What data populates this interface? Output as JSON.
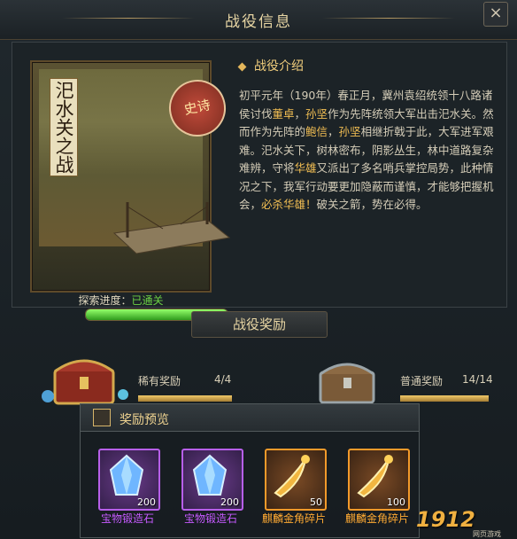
{
  "window": {
    "title": "战役信息",
    "close_label": "×"
  },
  "battle_card": {
    "name": "汜水关之战",
    "seal": "史诗",
    "progress_label": "探索进度：",
    "progress_status": "已通关",
    "progress": 1.0
  },
  "intro": {
    "heading": "战役介绍",
    "text_segments": [
      {
        "t": "初平元年（190年）春正月，冀州袁绍统领十八路诸侯讨伐",
        "style": "normal"
      },
      {
        "t": "董卓",
        "style": "gold"
      },
      {
        "t": "，",
        "style": "normal"
      },
      {
        "t": "孙坚",
        "style": "gold"
      },
      {
        "t": "作为先阵统领大军出击汜水关。然而作为先阵的",
        "style": "normal"
      },
      {
        "t": "鲍信",
        "style": "gold"
      },
      {
        "t": "，",
        "style": "normal"
      },
      {
        "t": "孙坚",
        "style": "gold"
      },
      {
        "t": "相继折戟于此，大军进军艰难。汜水关下，树林密布，阴影丛生，林中道路复杂难辨，守将",
        "style": "normal"
      },
      {
        "t": "华雄",
        "style": "gold"
      },
      {
        "t": "又派出了多名哨兵掌控局势，此种情况之下，我军行动要更加隐蔽而谨慎，才能够把握机会，",
        "style": "normal"
      },
      {
        "t": "必杀华雄！",
        "style": "gold"
      },
      {
        "t": "破关之箭，势在必得。",
        "style": "normal"
      }
    ]
  },
  "rewards": {
    "title": "战役奖励",
    "rare": {
      "label": "稀有奖励",
      "count": "4/4",
      "progress": 1.0
    },
    "normal": {
      "label": "普通奖励",
      "count": "14/14",
      "progress": 1.0
    }
  },
  "preview": {
    "title": "奖励预览",
    "items": [
      {
        "name": "宝物锻造石",
        "qty": "200",
        "rarity": "purple",
        "icon": "crystal-icon"
      },
      {
        "name": "宝物锻造石",
        "qty": "200",
        "rarity": "purple",
        "icon": "crystal-icon"
      },
      {
        "name": "麒麟金角碎片",
        "qty": "50",
        "rarity": "orange",
        "icon": "horn-icon"
      },
      {
        "name": "麒麟金角碎片",
        "qty": "100",
        "rarity": "orange",
        "icon": "horn-icon"
      }
    ]
  },
  "watermark": {
    "brand": "1912",
    "sub": "网页游戏"
  },
  "colors": {
    "gold": "#f3bf53",
    "green": "#6cd144",
    "purple": "#c65aff",
    "orange": "#ffaa33"
  }
}
